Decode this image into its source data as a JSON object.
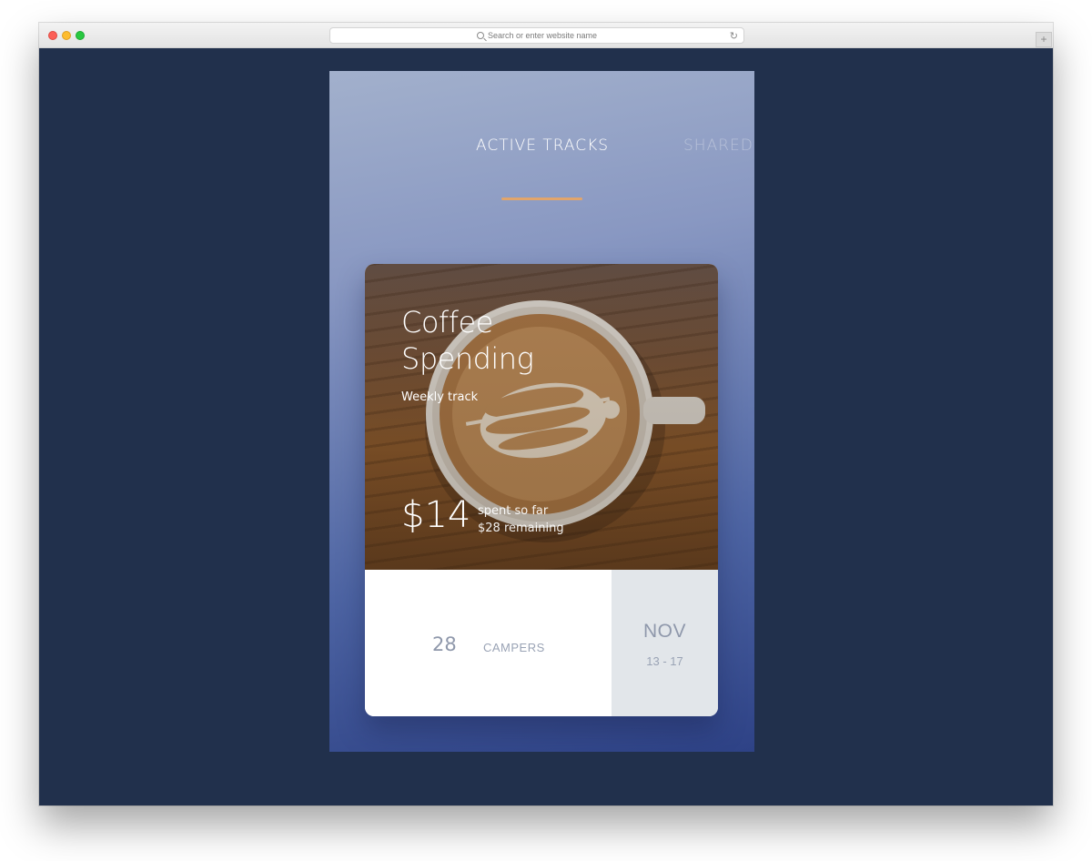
{
  "browser": {
    "address_placeholder": "Search or enter website name",
    "new_tab_label": "+"
  },
  "tabs": [
    {
      "label": "ACTIVE TRACKS",
      "active": true
    },
    {
      "label": "SHARED",
      "active": false
    }
  ],
  "card": {
    "title_line1": "Coffee",
    "title_line2": "Spending",
    "subtitle": "Weekly track",
    "amount": "$14",
    "spent_label": "spent so far",
    "remaining_label": "$28 remaining",
    "count": "28",
    "count_label": "CAMPERS",
    "month": "NOV",
    "date_range": "13 - 17"
  },
  "colors": {
    "background": "#21304c",
    "accent": "#e2a56b"
  }
}
